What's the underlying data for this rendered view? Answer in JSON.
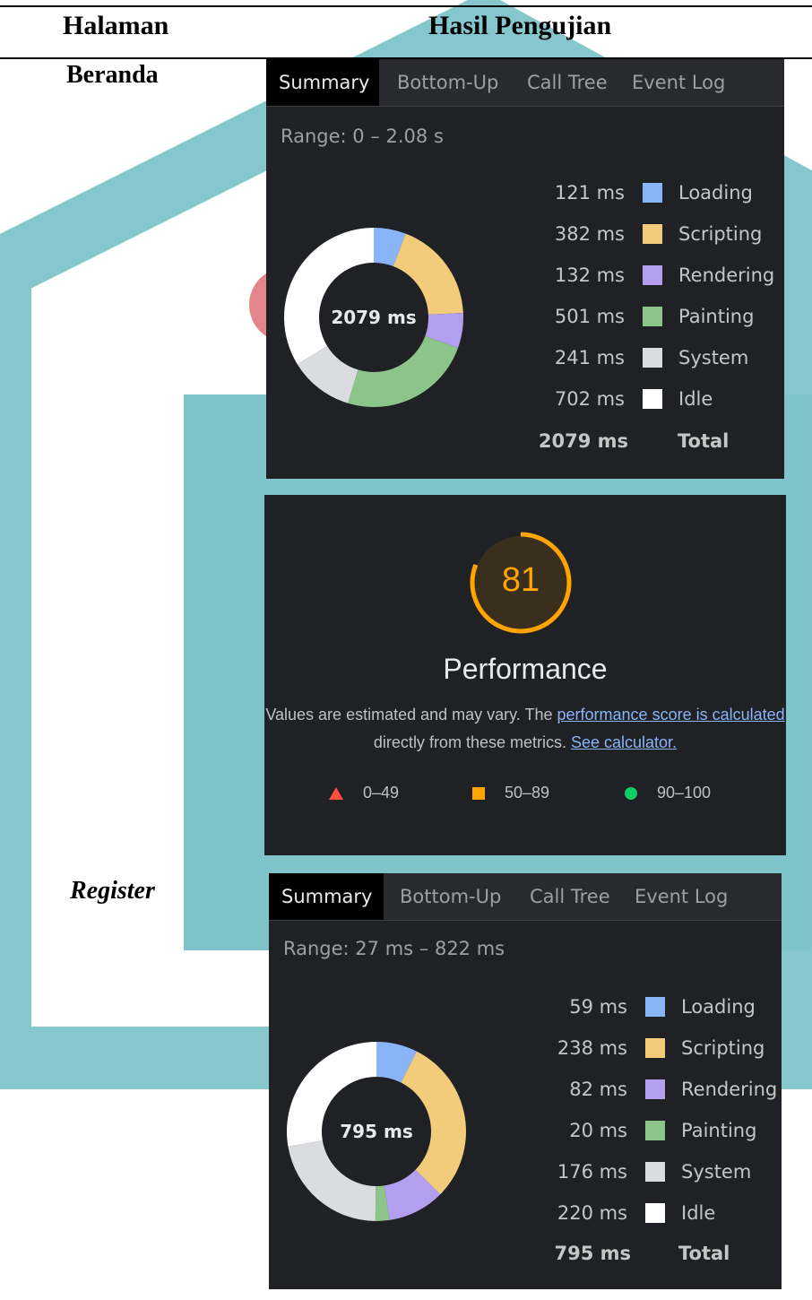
{
  "table": {
    "headers": {
      "page": "Halaman",
      "result": "Hasil Pengujian"
    },
    "rows": [
      {
        "label": "Beranda"
      },
      {
        "label": "Register"
      }
    ]
  },
  "colors": {
    "panel_bg": "#202124",
    "loading": "#8ab4f8",
    "scripting": "#f2cc7a",
    "rendering": "#b39ef0",
    "painting": "#8bc58a",
    "system": "#dadce0",
    "idle": "#ffffff",
    "lighthouse_average": "#ffa400",
    "lighthouse_fail": "#ff4e42",
    "lighthouse_pass": "#0cce6b",
    "link": "#8ab4f8"
  },
  "summary_panels": [
    {
      "tabs": [
        "Summary",
        "Bottom-Up",
        "Call Tree",
        "Event Log"
      ],
      "active_tab": "Summary",
      "range": "Range: 0 – 2.08 s",
      "center_label": "2079 ms",
      "legend": [
        {
          "value": "121 ms",
          "label": "Loading",
          "ms": 121,
          "color": "#8ab4f8"
        },
        {
          "value": "382 ms",
          "label": "Scripting",
          "ms": 382,
          "color": "#f2cc7a"
        },
        {
          "value": "132 ms",
          "label": "Rendering",
          "ms": 132,
          "color": "#b39ef0"
        },
        {
          "value": "501 ms",
          "label": "Painting",
          "ms": 501,
          "color": "#8bc58a"
        },
        {
          "value": "241 ms",
          "label": "System",
          "ms": 241,
          "color": "#dadce0"
        },
        {
          "value": "702 ms",
          "label": "Idle",
          "ms": 702,
          "color": "#ffffff"
        }
      ],
      "total_value": "2079 ms",
      "total_label": "Total"
    },
    {
      "tabs": [
        "Summary",
        "Bottom-Up",
        "Call Tree",
        "Event Log"
      ],
      "active_tab": "Summary",
      "range": "Range: 27 ms – 822 ms",
      "center_label": "795 ms",
      "legend": [
        {
          "value": "59 ms",
          "label": "Loading",
          "ms": 59,
          "color": "#8ab4f8"
        },
        {
          "value": "238 ms",
          "label": "Scripting",
          "ms": 238,
          "color": "#f2cc7a"
        },
        {
          "value": "82 ms",
          "label": "Rendering",
          "ms": 82,
          "color": "#b39ef0"
        },
        {
          "value": "20 ms",
          "label": "Painting",
          "ms": 20,
          "color": "#8bc58a"
        },
        {
          "value": "176 ms",
          "label": "System",
          "ms": 176,
          "color": "#dadce0"
        },
        {
          "value": "220 ms",
          "label": "Idle",
          "ms": 220,
          "color": "#ffffff"
        }
      ],
      "total_value": "795 ms",
      "total_label": "Total"
    }
  ],
  "lighthouse": {
    "score": "81",
    "score_fraction": 0.81,
    "title": "Performance",
    "desc_before": "Values are estimated and may vary. The ",
    "desc_link1": "performance score is calculated",
    "desc_mid": " directly from these metrics. ",
    "desc_link2": "See calculator.",
    "legend": [
      "0–49",
      "50–89",
      "90–100"
    ]
  }
}
